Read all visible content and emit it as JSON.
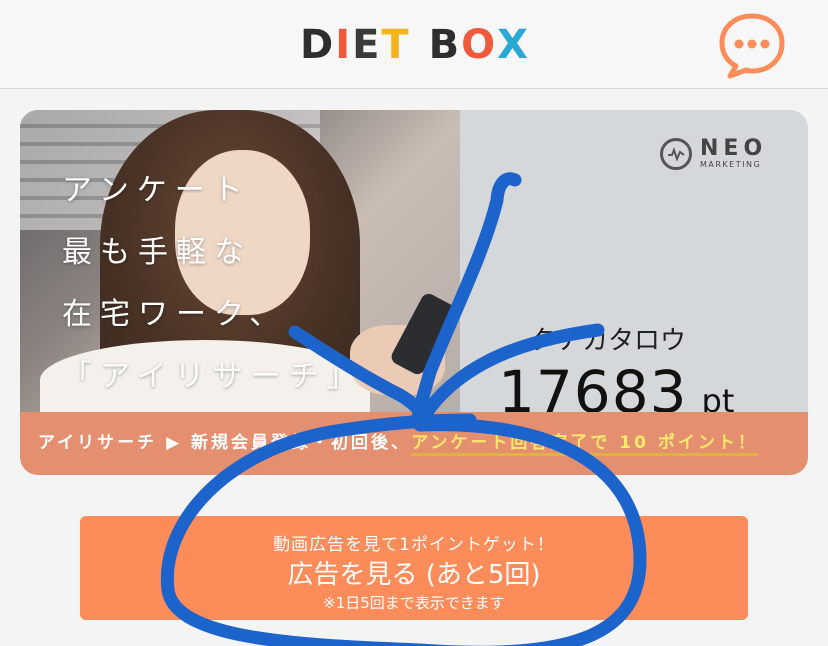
{
  "header": {
    "logo_letters": [
      {
        "char": "D",
        "color": "#2e2e2e"
      },
      {
        "char": "I",
        "color": "#f05a3c"
      },
      {
        "char": "E",
        "color": "#3a3a3a"
      },
      {
        "char": "T",
        "color": "#f3b51b"
      },
      {
        "char": " ",
        "color": "#ffffff"
      },
      {
        "char": "B",
        "color": "#2e2e2e"
      },
      {
        "char": "O",
        "color": "#f05a3c"
      },
      {
        "char": "X",
        "color": "#29a9d6"
      }
    ],
    "chat_icon": "speech-bubble-dots-icon",
    "accent_color": "#fd8c5b"
  },
  "banner": {
    "tagline": "アンケート\n最も手軽な\n在宅ワーク、\n「アイリサーチ」",
    "brand_title": "NEO",
    "brand_sub": "MARKETING",
    "user_name": "タナカタロウ",
    "points_value": "17683",
    "points_unit": "pt",
    "strip_text": "アイリサーチ ▶ 新規会員登録・初回後、",
    "strip_highlight": "アンケート回答完了で 10 ポイント！"
  },
  "cta": {
    "top": "動画広告を見て1ポイントゲット！",
    "main": "広告を見る (あと5回)",
    "note": "※1日5回まで表示できます"
  }
}
